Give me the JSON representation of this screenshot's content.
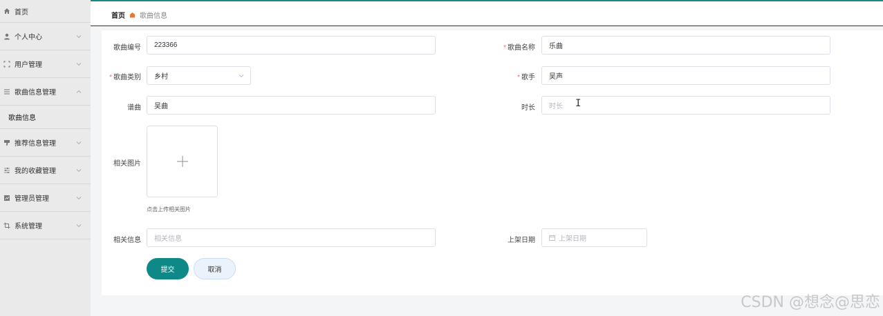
{
  "sidebar": {
    "home": "首页",
    "items": [
      {
        "label": "个人中心",
        "icon": "person-icon"
      },
      {
        "label": "用户管理",
        "icon": "frame-icon"
      },
      {
        "label": "歌曲信息管理",
        "icon": "list-icon",
        "expanded": true
      },
      {
        "label": "推荐信息管理",
        "icon": "thumb-icon"
      },
      {
        "label": "我的收藏管理",
        "icon": "sliders-icon"
      },
      {
        "label": "管理员管理",
        "icon": "chart-icon"
      },
      {
        "label": "系统管理",
        "icon": "crop-icon"
      }
    ],
    "sub_item": "歌曲信息"
  },
  "breadcrumb": {
    "home": "首页",
    "current": "歌曲信息"
  },
  "form": {
    "song_id": {
      "label": "歌曲编号",
      "value": "223366"
    },
    "song_name": {
      "label": "歌曲名称",
      "value": "乐曲"
    },
    "song_type": {
      "label": "歌曲类别",
      "value": "乡村"
    },
    "singer": {
      "label": "歌手",
      "value": "吴声"
    },
    "composer": {
      "label": "谱曲",
      "value": "吴曲"
    },
    "duration": {
      "label": "时长",
      "placeholder": "时长"
    },
    "image": {
      "label": "相关图片",
      "tip": "点击上传相关图片"
    },
    "info": {
      "label": "相关信息",
      "placeholder": "相关信息"
    },
    "release_date": {
      "label": "上架日期",
      "placeholder": "上架日期"
    },
    "required_mark": "*"
  },
  "buttons": {
    "submit": "提交",
    "cancel": "取消"
  },
  "watermark": "CSDN @想念@思恋",
  "colors": {
    "primary": "#0f8987",
    "required": "#f56c6c",
    "breadcrumb_sep": "#e6772d"
  }
}
